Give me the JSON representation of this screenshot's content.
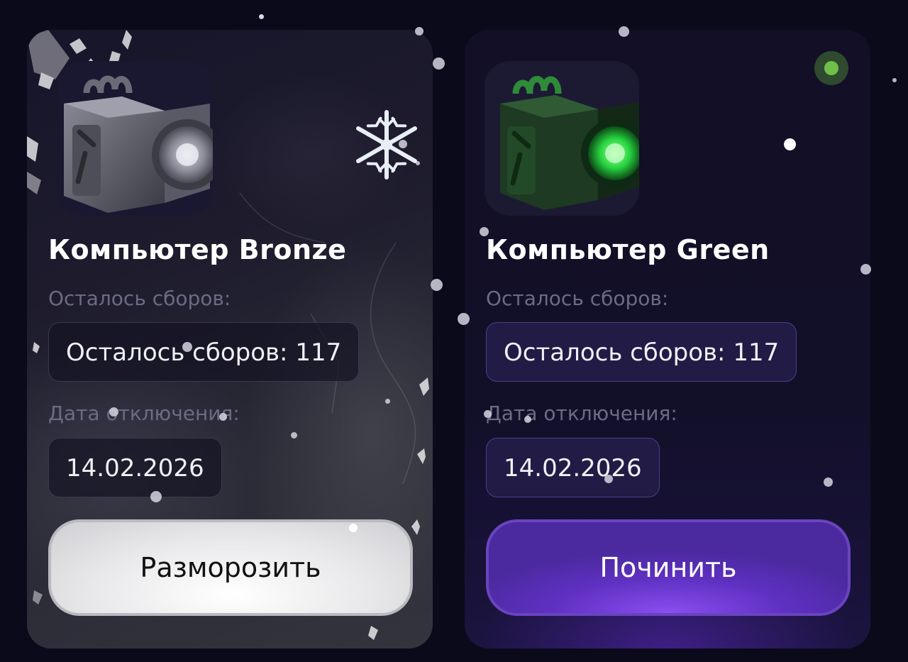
{
  "cards": [
    {
      "name": "Компьютер Bronze",
      "remaining_label": "Осталось сборов:",
      "remaining_value": "Осталось сборов: 117",
      "shutdown_label": "Дата отключения:",
      "shutdown_value": "14.02.2026",
      "action": "Разморозить",
      "state": "frozen"
    },
    {
      "name": "Компьютер Green",
      "remaining_label": "Осталось сборов:",
      "remaining_value": "Осталось сборов: 117",
      "shutdown_label": "Дата отключения:",
      "shutdown_value": "14.02.2026",
      "action": "Починить",
      "state": "active",
      "status_color": "#6fbf4a"
    }
  ],
  "icons": [
    "miner-bronze-icon",
    "miner-green-icon",
    "snowflake-icon",
    "status-dot-icon"
  ],
  "colors": {
    "background": "#0b0a1a",
    "accent": "#7b45e6",
    "green": "#3fd25a"
  }
}
